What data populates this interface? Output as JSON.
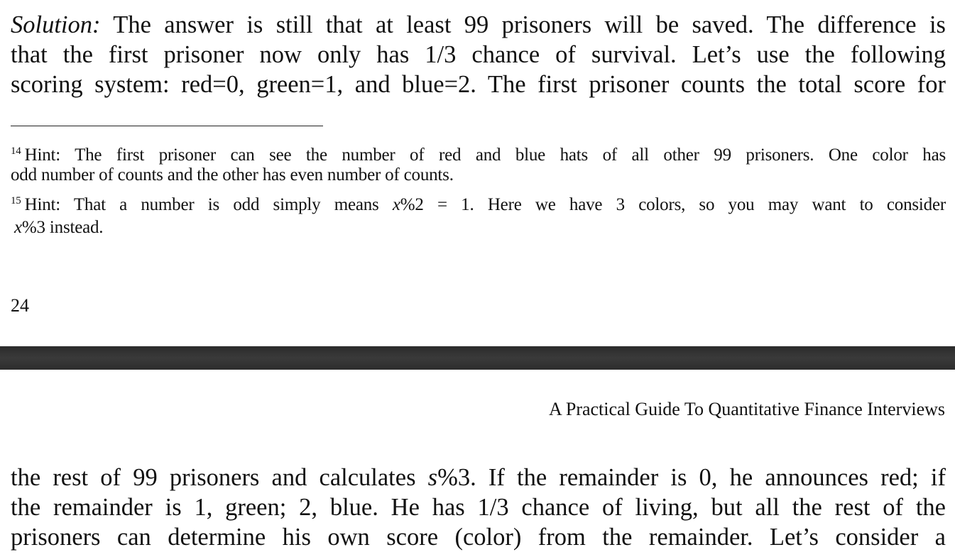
{
  "page_top": {
    "paragraph": {
      "lead": "Solution:",
      "line1_rest": " The answer is still that at least 99 prisoners will be saved. The difference is",
      "line2": "that the first prisoner now only has 1/3 chance of survival. Let’s use the following",
      "line3": "scoring system: red=0, green=1, and blue=2. The first prisoner counts the total score for"
    },
    "footnotes": [
      {
        "mark": "14",
        "line1": "Hint: The first prisoner can see the number of red and blue hats of all other 99 prisoners. One color has",
        "line2": "odd number of counts and the other has even number of counts."
      },
      {
        "mark": "15",
        "line1_before": "Hint: That a number is odd simply means ",
        "math1": "x",
        "math1_rest": "%2 = 1",
        "line1_after": ". Here we have 3 colors, so you may want to consider",
        "math2": "x",
        "math2_rest": "%3",
        "line2_after": " instead."
      }
    ],
    "page_number": "24"
  },
  "page_bottom": {
    "running_header": "A Practical Guide To Quantitative Finance Interviews",
    "paragraph": {
      "line1_before": "the rest of 99 prisoners and calculates ",
      "line1_math": "s",
      "line1_after": "%3. If the remainder is 0, he announces red; if",
      "line2": "the remainder is 1, green; 2, blue. He has 1/3 chance of living, but all the rest of the",
      "line3": "prisoners can determine his own score (color) from the remainder. Let’s consider a"
    }
  }
}
